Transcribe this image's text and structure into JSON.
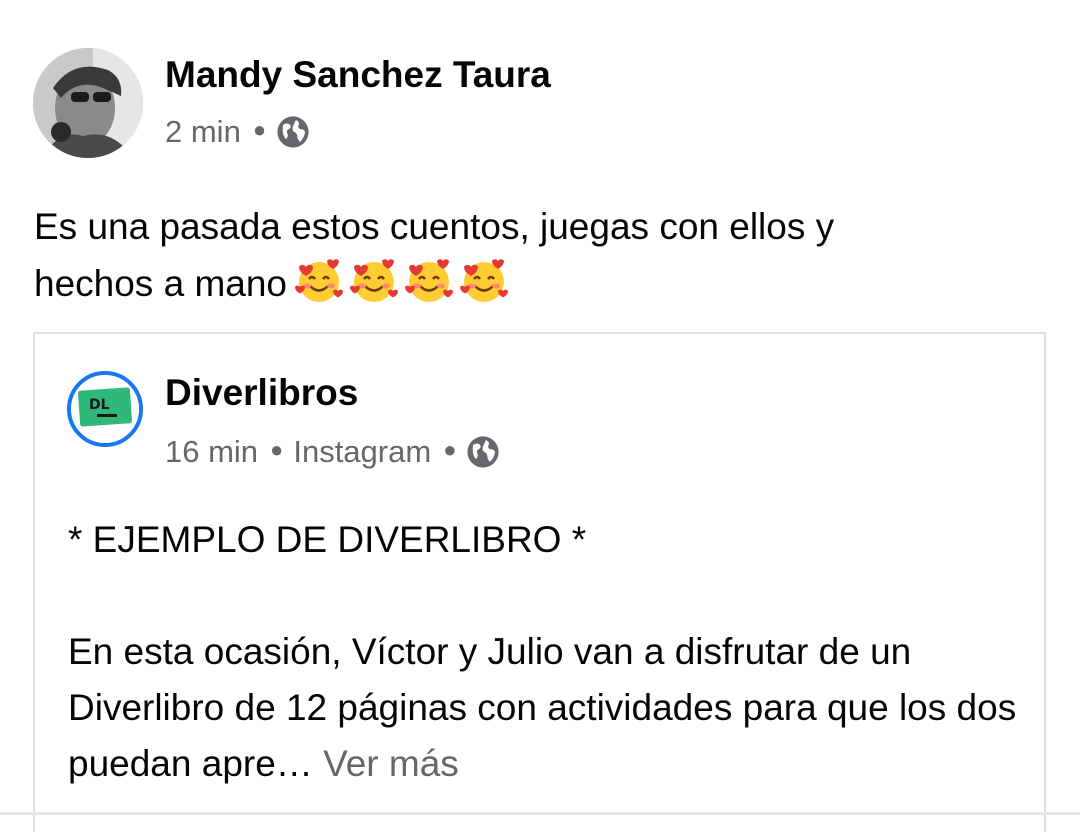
{
  "post": {
    "author": "Mandy Sanchez Taura",
    "time": "2 min",
    "audience_icon": "globe-icon",
    "text_line1": "Es una pasada estos cuentos, juegas con ellos y",
    "text_line2": "hechos a mano",
    "emojis": [
      "smiling-face-with-hearts",
      "smiling-face-with-hearts",
      "smiling-face-with-hearts",
      "smiling-face-with-hearts"
    ]
  },
  "shared": {
    "page_name": "Diverlibros",
    "time": "16 min",
    "source": "Instagram",
    "audience_icon": "globe-icon",
    "headline": "* EJEMPLO DE DIVERLIBRO *",
    "body": "En esta ocasión, Víctor y Julio van a disfrutar de un Diverlibro de 12 páginas con actividades para que los dos puedan apre…",
    "see_more": "Ver más",
    "logo_text": "DL"
  },
  "colors": {
    "text_primary": "#050505",
    "text_secondary": "#65676b",
    "border": "#dddfe2",
    "page_ring": "#1877f2",
    "logo_green": "#2fb87a"
  }
}
